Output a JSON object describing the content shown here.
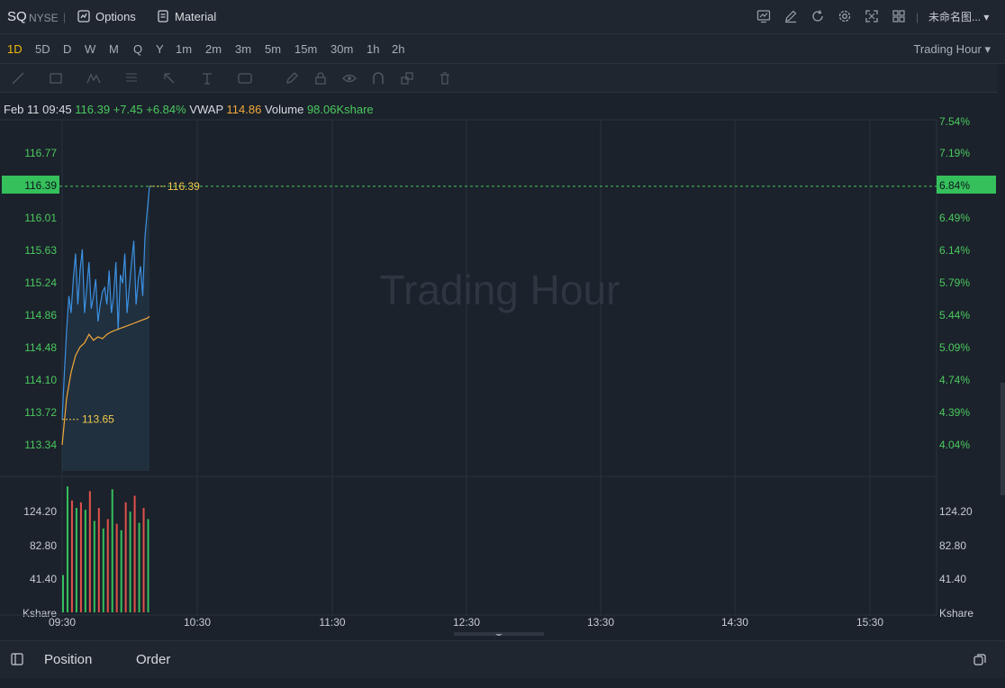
{
  "header": {
    "symbol": "SQ",
    "exchange": "NYSE",
    "separator": "|",
    "options_label": "Options",
    "material_label": "Material",
    "layout_name": "未命名图... ▾",
    "right_icons": [
      "indicator-icon",
      "draw-edit-icon",
      "refresh-icon",
      "settings-gear-icon",
      "fullscreen-icon",
      "grid-layout-icon"
    ]
  },
  "periods": {
    "items": [
      "1D",
      "5D",
      "D",
      "W",
      "M",
      "Q",
      "Y",
      "1m",
      "2m",
      "3m",
      "5m",
      "15m",
      "30m",
      "1h",
      "2h"
    ],
    "active": "1D",
    "trading_hour_label": "Trading Hour ▾"
  },
  "drawing_tools": [
    "trend-line-icon",
    "rectangle-icon",
    "pattern-icon",
    "fib-icon",
    "arrow-icon",
    "text-tool-icon",
    "note-icon",
    "pen-icon",
    "lock-icon",
    "eye-icon",
    "magnet-icon",
    "link-icon",
    "trash-icon"
  ],
  "info": {
    "date": "Feb 11 09:45",
    "price": "116.39",
    "change": "+7.45",
    "change_pct": "+6.84%",
    "vwap_label": "VWAP",
    "vwap_value": "114.86",
    "volume_label": "Volume",
    "volume_value": "98.06Kshare"
  },
  "chart_data": {
    "type": "line",
    "watermark": "Trading Hour",
    "price_axis_left": [
      "116.77",
      "116.01",
      "115.63",
      "115.24",
      "114.86",
      "114.48",
      "114.10",
      "113.72",
      "113.34"
    ],
    "price_axis_right": [
      "7.54%",
      "7.19%",
      "6.49%",
      "6.14%",
      "5.79%",
      "5.44%",
      "5.09%",
      "4.74%",
      "4.39%",
      "4.04%"
    ],
    "current_price_tag": "116.39",
    "current_pct_tag": "6.84%",
    "high_label": "116.39",
    "low_label": "113.65",
    "volume_axis": [
      "124.20",
      "82.80",
      "41.40"
    ],
    "volume_unit": "Kshare",
    "time_axis": [
      "09:30",
      "10:30",
      "11:30",
      "12:30",
      "13:30",
      "14:30",
      "15:30"
    ],
    "ylim": [
      113.1,
      117.2
    ],
    "xlim": [
      0,
      390
    ],
    "series": [
      {
        "color": "#3c8fe0",
        "points": [
          [
            0,
            113.65
          ],
          [
            1,
            114.2
          ],
          [
            2,
            114.7
          ],
          [
            3,
            115.1
          ],
          [
            4,
            114.9
          ],
          [
            5,
            115.3
          ],
          [
            6,
            115.6
          ],
          [
            7,
            115.0
          ],
          [
            8,
            115.4
          ],
          [
            9,
            115.65
          ],
          [
            10,
            114.9
          ],
          [
            11,
            115.2
          ],
          [
            12,
            115.5
          ],
          [
            13,
            114.95
          ],
          [
            14,
            115.1
          ],
          [
            15,
            115.3
          ],
          [
            16,
            114.8
          ],
          [
            17,
            115.0
          ],
          [
            18,
            115.15
          ],
          [
            19,
            115.2
          ],
          [
            20,
            115.0
          ],
          [
            21,
            115.4
          ],
          [
            22,
            114.9
          ],
          [
            23,
            115.1
          ],
          [
            24,
            115.5
          ],
          [
            25,
            114.7
          ],
          [
            26,
            115.35
          ],
          [
            27,
            115.25
          ],
          [
            28,
            115.6
          ],
          [
            29,
            114.9
          ],
          [
            30,
            115.2
          ],
          [
            31,
            115.5
          ],
          [
            32,
            115.75
          ],
          [
            33,
            115.0
          ],
          [
            34,
            115.3
          ],
          [
            35,
            115.45
          ],
          [
            36,
            115.1
          ],
          [
            37,
            115.8
          ],
          [
            38,
            116.1
          ],
          [
            39,
            116.39
          ]
        ]
      },
      {
        "color": "#f2a83a",
        "points": [
          [
            0,
            113.35
          ],
          [
            2,
            113.9
          ],
          [
            4,
            114.2
          ],
          [
            6,
            114.4
          ],
          [
            8,
            114.5
          ],
          [
            10,
            114.55
          ],
          [
            12,
            114.65
          ],
          [
            14,
            114.58
          ],
          [
            16,
            114.62
          ],
          [
            18,
            114.6
          ],
          [
            20,
            114.65
          ],
          [
            22,
            114.68
          ],
          [
            24,
            114.7
          ],
          [
            26,
            114.72
          ],
          [
            28,
            114.74
          ],
          [
            30,
            114.76
          ],
          [
            32,
            114.78
          ],
          [
            34,
            114.8
          ],
          [
            36,
            114.82
          ],
          [
            38,
            114.84
          ],
          [
            39,
            114.86
          ]
        ]
      }
    ],
    "volume": {
      "ymax": 140,
      "bars": [
        {
          "t": 0,
          "v": 40,
          "up": true
        },
        {
          "t": 2,
          "v": 135,
          "up": true
        },
        {
          "t": 4,
          "v": 120,
          "up": false
        },
        {
          "t": 6,
          "v": 112,
          "up": true
        },
        {
          "t": 8,
          "v": 118,
          "up": false
        },
        {
          "t": 10,
          "v": 110,
          "up": true
        },
        {
          "t": 12,
          "v": 130,
          "up": false
        },
        {
          "t": 14,
          "v": 98,
          "up": true
        },
        {
          "t": 16,
          "v": 112,
          "up": false
        },
        {
          "t": 18,
          "v": 90,
          "up": true
        },
        {
          "t": 20,
          "v": 100,
          "up": false
        },
        {
          "t": 22,
          "v": 132,
          "up": true
        },
        {
          "t": 24,
          "v": 95,
          "up": false
        },
        {
          "t": 26,
          "v": 88,
          "up": true
        },
        {
          "t": 28,
          "v": 118,
          "up": false
        },
        {
          "t": 30,
          "v": 108,
          "up": true
        },
        {
          "t": 32,
          "v": 125,
          "up": false
        },
        {
          "t": 34,
          "v": 96,
          "up": true
        },
        {
          "t": 36,
          "v": 112,
          "up": false
        },
        {
          "t": 38,
          "v": 100,
          "up": true
        }
      ]
    }
  },
  "bottom": {
    "position_label": "Position",
    "order_label": "Order"
  },
  "colors": {
    "up": "#35c05c",
    "down": "#e0524a",
    "price_line": "#3c8fe0",
    "vwap": "#f2a83a",
    "accent": "#f0b90b"
  }
}
